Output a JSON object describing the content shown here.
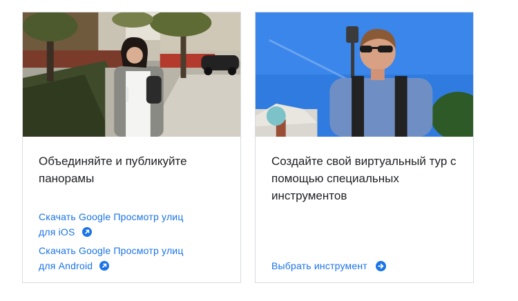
{
  "cards": [
    {
      "title": "Объединяйте и публикуйте панорамы",
      "links": [
        {
          "line1": "Скачать Google Просмотр улиц",
          "line2": "для iOS",
          "icon": "external-link-icon"
        },
        {
          "line1": "Скачать Google Просмотр улиц",
          "line2": "для Android",
          "icon": "external-link-icon"
        }
      ],
      "image": "street-photo-woman-with-camera"
    },
    {
      "title": "Создайте свой виртуальный тур с помощью специальных инструментов",
      "link": {
        "label": "Выбрать инструмент",
        "icon": "arrow-right-circle-icon"
      },
      "image": "man-with-360-camera-on-pole"
    }
  ],
  "colors": {
    "link": "#1a73e8",
    "text": "#202124",
    "border": "#dadce0"
  }
}
